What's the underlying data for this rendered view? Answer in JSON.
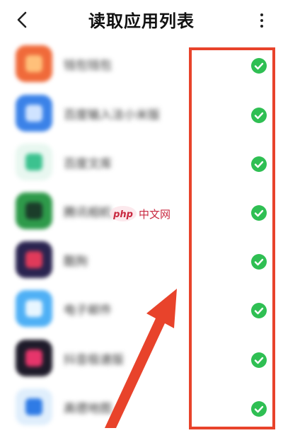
{
  "header": {
    "back_icon": "chevron-left-icon",
    "title": "读取应用列表",
    "more_icon": "more-vertical-icon"
  },
  "apps": [
    {
      "name": "钱包钱包",
      "icon_color": "#f06a3a",
      "icon_accent": "#ffc07a",
      "checked": true
    },
    {
      "name": "百度输入法小米版",
      "icon_color": "#3b82e8",
      "icon_accent": "#cfe3ff",
      "checked": true
    },
    {
      "name": "百度文库",
      "icon_color": "#e8f7f0",
      "icon_accent": "#3cc28f",
      "checked": true
    },
    {
      "name": "腾讯相机",
      "icon_color": "#2e9a4a",
      "icon_accent": "#1b3d2a",
      "checked": true
    },
    {
      "name": "酷狗",
      "icon_color": "#2a2450",
      "icon_accent": "#e03a5a",
      "checked": true
    },
    {
      "name": "电子邮件",
      "icon_color": "#4fb0f5",
      "icon_accent": "#e8f6ff",
      "checked": true
    },
    {
      "name": "抖音极速版",
      "icon_color": "#1e1b2a",
      "icon_accent": "#e6356b",
      "checked": true
    },
    {
      "name": "高德地图",
      "icon_color": "#dfeefc",
      "icon_accent": "#2f7be5",
      "checked": true
    }
  ],
  "colors": {
    "check_green": "#2fbf53",
    "highlight_red": "#e8432b"
  },
  "watermark": {
    "logo_text": "php",
    "site_text": "中文网"
  }
}
